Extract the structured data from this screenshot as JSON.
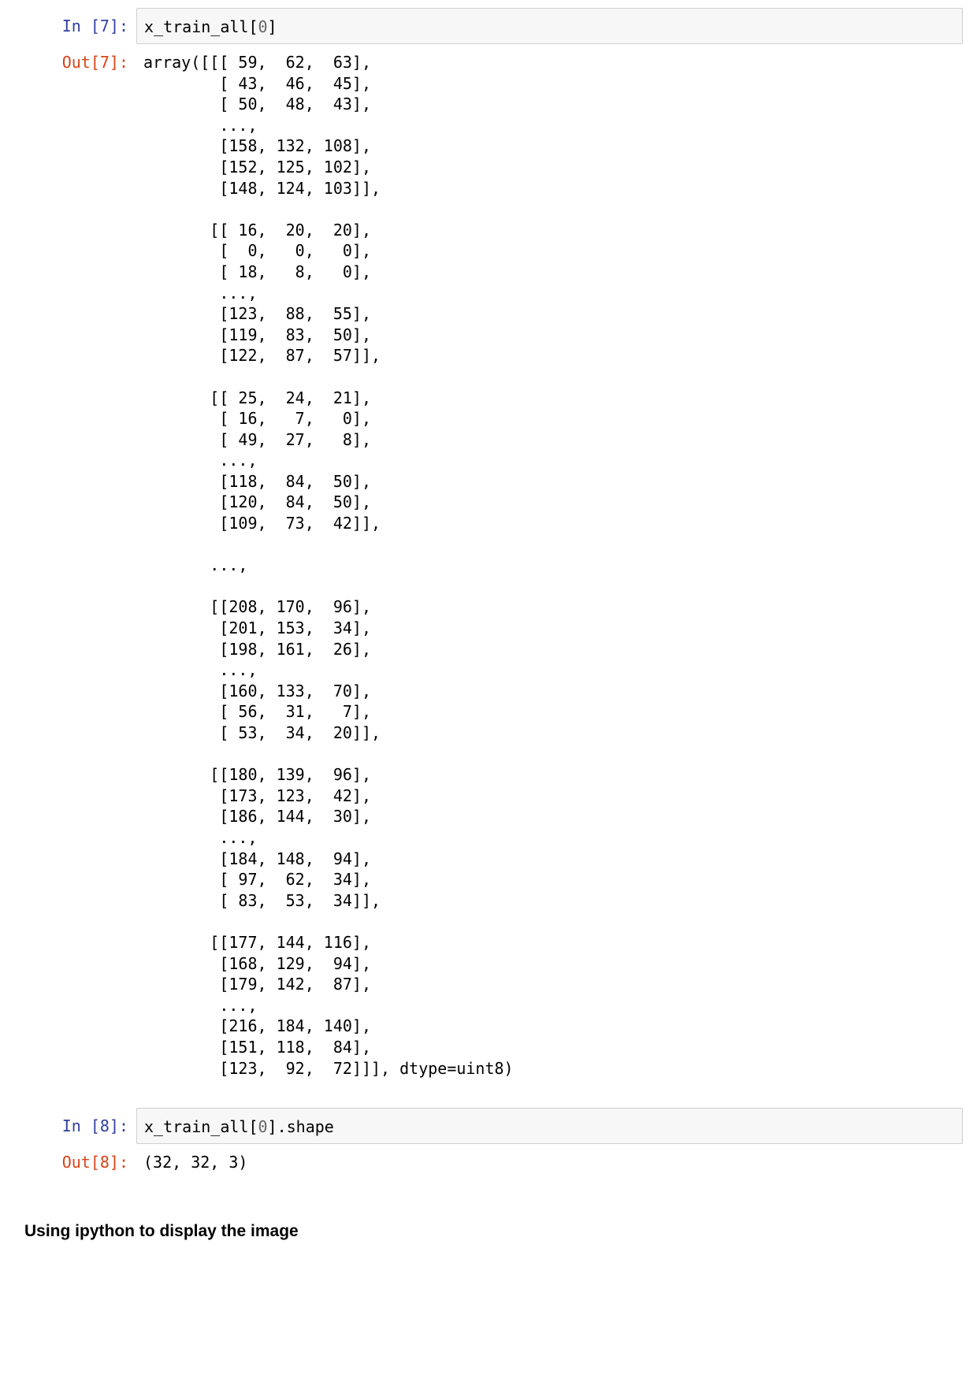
{
  "cells": [
    {
      "in_prompt": "In [7]:",
      "code_before": "x_train_all[",
      "code_num": "0",
      "code_after": "]",
      "out_prompt": "Out[7]:",
      "output": "array([[[ 59,  62,  63],\n        [ 43,  46,  45],\n        [ 50,  48,  43],\n        ...,\n        [158, 132, 108],\n        [152, 125, 102],\n        [148, 124, 103]],\n\n       [[ 16,  20,  20],\n        [  0,   0,   0],\n        [ 18,   8,   0],\n        ...,\n        [123,  88,  55],\n        [119,  83,  50],\n        [122,  87,  57]],\n\n       [[ 25,  24,  21],\n        [ 16,   7,   0],\n        [ 49,  27,   8],\n        ...,\n        [118,  84,  50],\n        [120,  84,  50],\n        [109,  73,  42]],\n\n       ...,\n\n       [[208, 170,  96],\n        [201, 153,  34],\n        [198, 161,  26],\n        ...,\n        [160, 133,  70],\n        [ 56,  31,   7],\n        [ 53,  34,  20]],\n\n       [[180, 139,  96],\n        [173, 123,  42],\n        [186, 144,  30],\n        ...,\n        [184, 148,  94],\n        [ 97,  62,  34],\n        [ 83,  53,  34]],\n\n       [[177, 144, 116],\n        [168, 129,  94],\n        [179, 142,  87],\n        ...,\n        [216, 184, 140],\n        [151, 118,  84],\n        [123,  92,  72]]], dtype=uint8)"
    },
    {
      "in_prompt": "In [8]:",
      "code_before": "x_train_all[",
      "code_num": "0",
      "code_after": "].shape",
      "out_prompt": "Out[8]:",
      "output": "(32, 32, 3)"
    }
  ],
  "markdown": {
    "heading": "Using ipython to display the image"
  },
  "colors": {
    "in_prompt": "#303f9f",
    "out_prompt": "#d84315",
    "input_bg": "#f7f7f7",
    "input_border": "#cfcfcf",
    "number": "#666666"
  }
}
